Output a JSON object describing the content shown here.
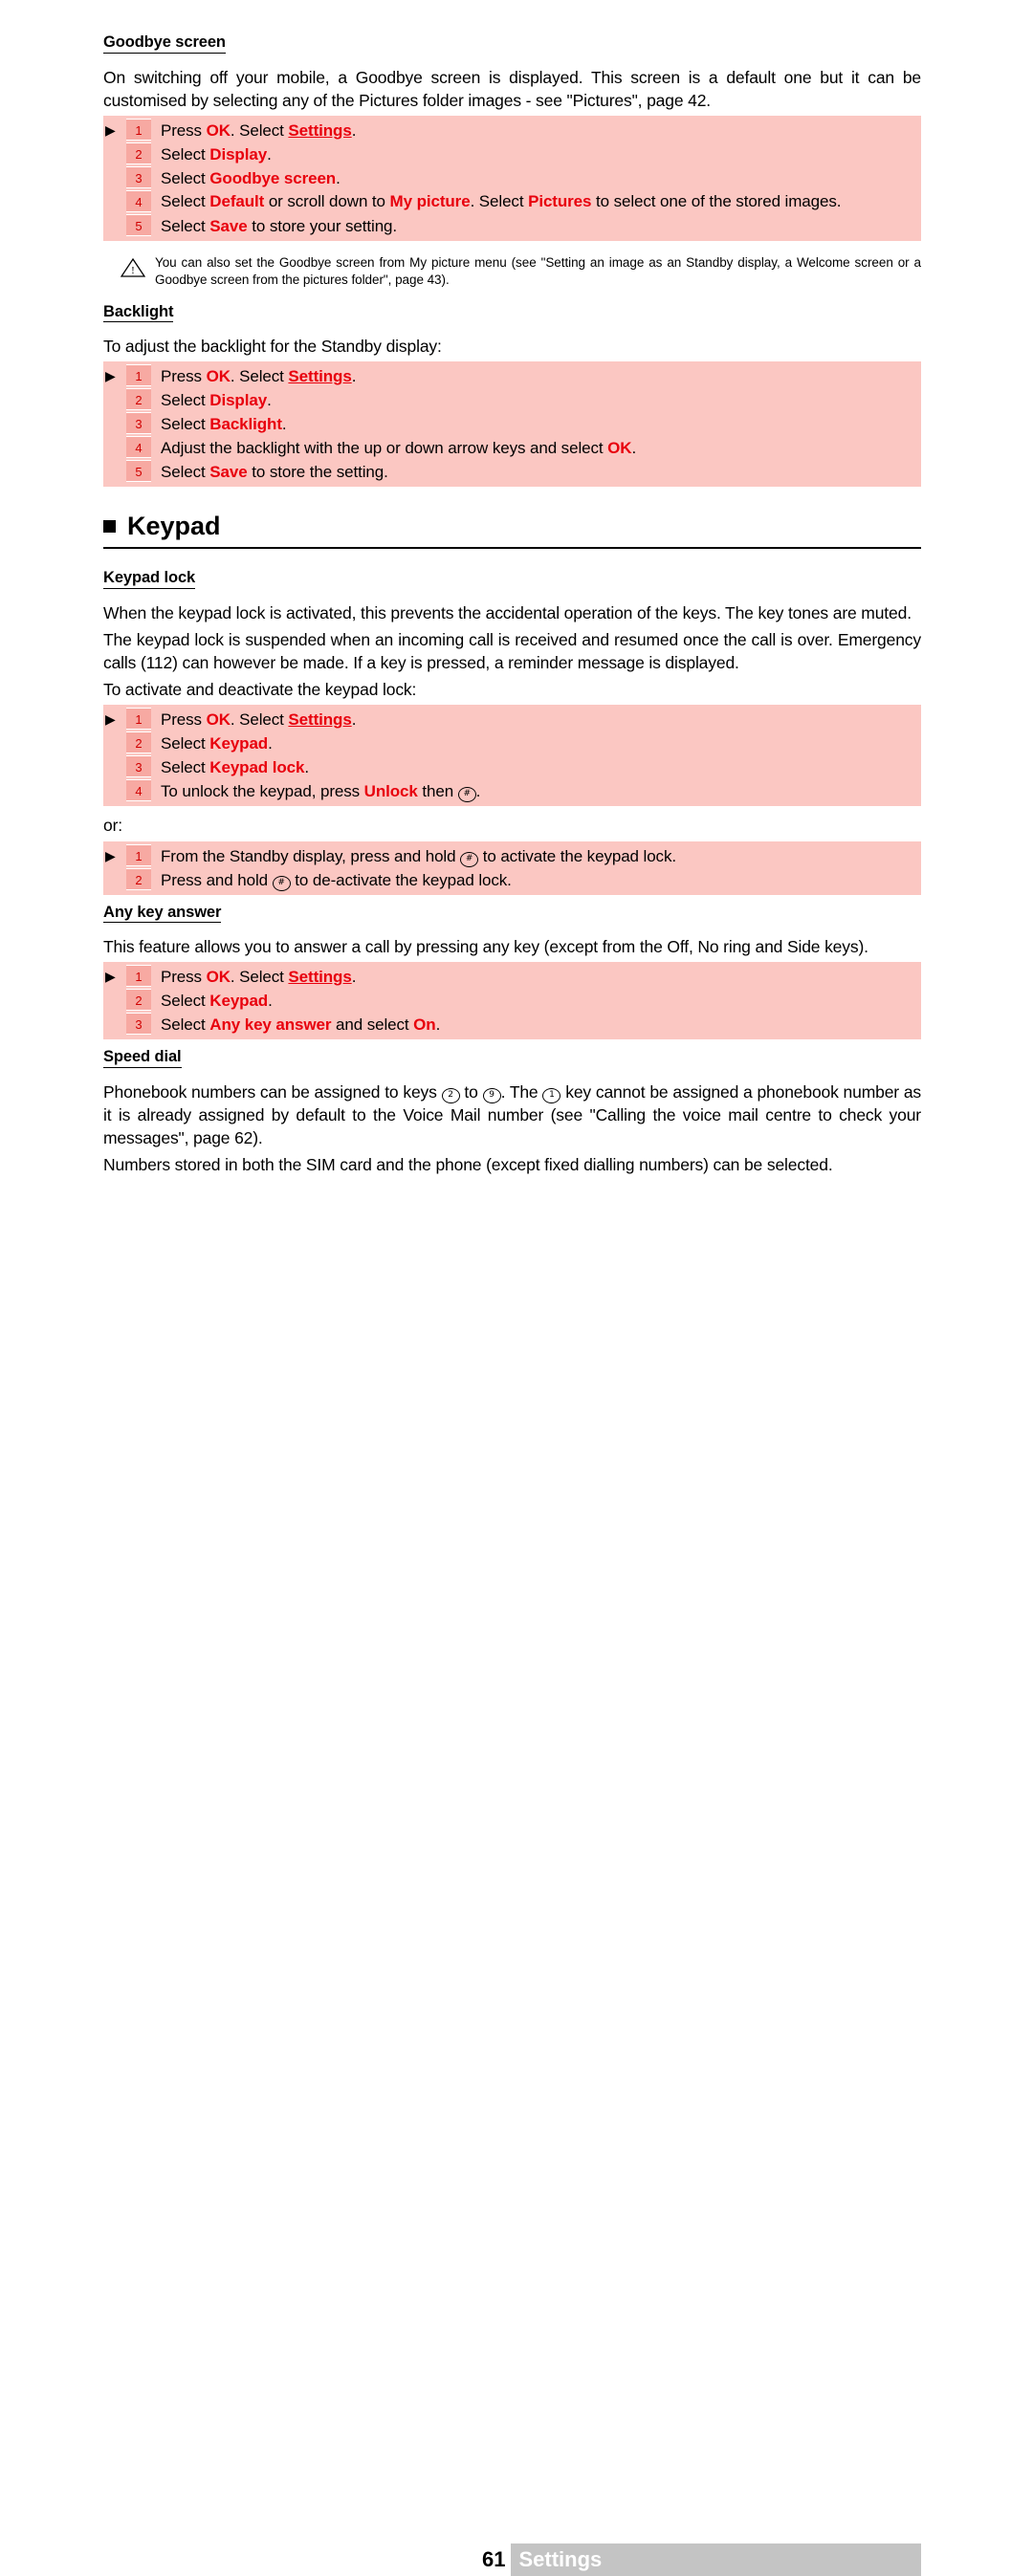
{
  "sections": {
    "goodbye": {
      "heading": "Goodbye screen",
      "intro": "On switching off your mobile, a Goodbye screen is displayed. This screen is a default one but it can be customised by selecting any of the Pictures folder images - see \"Pictures\", page 42.",
      "steps": [
        {
          "num": "1",
          "parts": [
            {
              "t": "Press ",
              "s": "n"
            },
            {
              "t": "OK",
              "s": "red"
            },
            {
              "t": ". Select ",
              "s": "n"
            },
            {
              "t": "Settings",
              "s": "redu"
            },
            {
              "t": ".",
              "s": "n"
            }
          ]
        },
        {
          "num": "2",
          "parts": [
            {
              "t": "Select ",
              "s": "n"
            },
            {
              "t": "Display",
              "s": "red"
            },
            {
              "t": ".",
              "s": "n"
            }
          ]
        },
        {
          "num": "3",
          "parts": [
            {
              "t": "Select ",
              "s": "n"
            },
            {
              "t": "Goodbye screen",
              "s": "red"
            },
            {
              "t": ".",
              "s": "n"
            }
          ]
        },
        {
          "num": "4",
          "parts": [
            {
              "t": "Select ",
              "s": "n"
            },
            {
              "t": "Default",
              "s": "red"
            },
            {
              "t": " or scroll down to ",
              "s": "n"
            },
            {
              "t": "My picture",
              "s": "red"
            },
            {
              "t": ". Select ",
              "s": "n"
            },
            {
              "t": "Pictures",
              "s": "red"
            },
            {
              "t": " to select one of the stored images.",
              "s": "n"
            }
          ]
        },
        {
          "num": "5",
          "parts": [
            {
              "t": "Select ",
              "s": "n"
            },
            {
              "t": "Save",
              "s": "red"
            },
            {
              "t": " to store your setting.",
              "s": "n"
            }
          ]
        }
      ],
      "note": "You can also set the Goodbye screen from My picture menu (see \"Setting an image as an Standby display, a Welcome screen or a Goodbye screen from the pictures folder\", page 43)."
    },
    "backlight": {
      "heading": "Backlight",
      "intro": "To adjust the backlight for the Standby display:",
      "steps": [
        {
          "num": "1",
          "parts": [
            {
              "t": "Press ",
              "s": "n"
            },
            {
              "t": "OK",
              "s": "red"
            },
            {
              "t": ". Select ",
              "s": "n"
            },
            {
              "t": "Settings",
              "s": "redu"
            },
            {
              "t": ".",
              "s": "n"
            }
          ]
        },
        {
          "num": "2",
          "parts": [
            {
              "t": "Select ",
              "s": "n"
            },
            {
              "t": "Display",
              "s": "red"
            },
            {
              "t": ".",
              "s": "n"
            }
          ]
        },
        {
          "num": "3",
          "parts": [
            {
              "t": "Select ",
              "s": "n"
            },
            {
              "t": "Backlight",
              "s": "red"
            },
            {
              "t": ".",
              "s": "n"
            }
          ]
        },
        {
          "num": "4",
          "parts": [
            {
              "t": "Adjust the backlight with the up or down arrow keys and select ",
              "s": "n"
            },
            {
              "t": "OK",
              "s": "red"
            },
            {
              "t": ".",
              "s": "n"
            }
          ]
        },
        {
          "num": "5",
          "parts": [
            {
              "t": "Select ",
              "s": "n"
            },
            {
              "t": "Save",
              "s": "red"
            },
            {
              "t": " to store the setting.",
              "s": "n"
            }
          ]
        }
      ]
    },
    "keypad": {
      "title": "Keypad",
      "lock": {
        "heading": "Keypad lock",
        "para1": "When the keypad lock is activated, this prevents the accidental operation of the keys. The key tones are muted.",
        "para2": "The keypad lock is suspended when an incoming call is received and resumed once the call is over. Emergency calls (112) can however be made. If a key is pressed, a reminder message is displayed.",
        "para3": "To activate and deactivate the keypad lock:",
        "steps": [
          {
            "num": "1",
            "parts": [
              {
                "t": "Press ",
                "s": "n"
              },
              {
                "t": "OK",
                "s": "red"
              },
              {
                "t": ". Select ",
                "s": "n"
              },
              {
                "t": "Settings",
                "s": "redu"
              },
              {
                "t": ".",
                "s": "n"
              }
            ]
          },
          {
            "num": "2",
            "parts": [
              {
                "t": "Select ",
                "s": "n"
              },
              {
                "t": "Keypad",
                "s": "red"
              },
              {
                "t": ".",
                "s": "n"
              }
            ]
          },
          {
            "num": "3",
            "parts": [
              {
                "t": "Select ",
                "s": "n"
              },
              {
                "t": "Keypad lock",
                "s": "red"
              },
              {
                "t": ".",
                "s": "n"
              }
            ]
          },
          {
            "num": "4",
            "parts": [
              {
                "t": "To unlock the keypad, press ",
                "s": "n"
              },
              {
                "t": "Unlock",
                "s": "red"
              },
              {
                "t": " then ",
                "s": "n"
              },
              {
                "t": "#",
                "s": "key"
              },
              {
                "t": ".",
                "s": "n"
              }
            ]
          }
        ],
        "or_label": "or:",
        "steps2": [
          {
            "num": "1",
            "parts": [
              {
                "t": "From the Standby display, press and hold ",
                "s": "n"
              },
              {
                "t": "#",
                "s": "key"
              },
              {
                "t": " to activate the keypad lock.",
                "s": "n"
              }
            ]
          },
          {
            "num": "2",
            "parts": [
              {
                "t": "Press and hold ",
                "s": "n"
              },
              {
                "t": "#",
                "s": "key"
              },
              {
                "t": " to de-activate the keypad lock.",
                "s": "n"
              }
            ]
          }
        ]
      },
      "anykey": {
        "heading": "Any key answer",
        "intro": "This feature allows you to answer a call by pressing any key (except from the Off, No ring and Side keys).",
        "steps": [
          {
            "num": "1",
            "parts": [
              {
                "t": "Press ",
                "s": "n"
              },
              {
                "t": "OK",
                "s": "red"
              },
              {
                "t": ". Select ",
                "s": "n"
              },
              {
                "t": "Settings",
                "s": "redu"
              },
              {
                "t": ".",
                "s": "n"
              }
            ]
          },
          {
            "num": "2",
            "parts": [
              {
                "t": "Select ",
                "s": "n"
              },
              {
                "t": "Keypad",
                "s": "red"
              },
              {
                "t": ".",
                "s": "n"
              }
            ]
          },
          {
            "num": "3",
            "parts": [
              {
                "t": "Select ",
                "s": "n"
              },
              {
                "t": "Any key answer",
                "s": "red"
              },
              {
                "t": " and select ",
                "s": "n"
              },
              {
                "t": "On",
                "s": "red"
              },
              {
                "t": ".",
                "s": "n"
              }
            ]
          }
        ]
      },
      "speeddial": {
        "heading": "Speed dial",
        "para1_a": "Phonebook numbers can be assigned to keys ",
        "key2": "2",
        "para1_b": " to ",
        "key9": "9",
        "para1_c": ". The ",
        "key1": "1",
        "para1_d": " key cannot be assigned a phonebook number  as it is already assigned by default to the Voice Mail number  (see \"Calling the voice mail centre to check your messages\", page 62).",
        "para2": "Numbers stored in both the SIM card and the phone  (except fixed dialling numbers) can be selected."
      }
    }
  },
  "footer": {
    "page_number": "61",
    "title": "Settings"
  }
}
